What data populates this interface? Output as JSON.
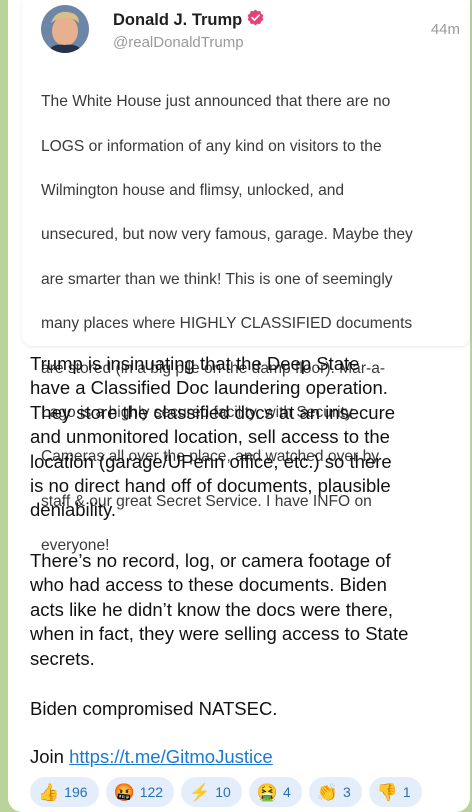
{
  "embedded_post": {
    "author_name": "Donald J. Trump",
    "handle": "@realDonaldTrump",
    "time": "44m",
    "lines": [
      "The White House just announced that there are no",
      "LOGS or information of any kind on visitors to the",
      "Wilmington house and flimsy, unlocked, and",
      "unsecured, but now very famous, garage. Maybe they",
      "are smarter than we think! This is one of seemingly",
      "many places where HIGHLY CLASSIFIED documents",
      "are stored (in a big pile on the damp floor). Mar-a-",
      "Lago is a highly secured facility, with Security",
      "Cameras all over the place, and watched over by",
      "staff & our great Secret Service. I have INFO on",
      "everyone!"
    ]
  },
  "message": {
    "paragraph1_lines": [
      "Trump is insinuating that the Deep State",
      "have a Classified Doc laundering operation.",
      "They store the classified docs at an insecure",
      "and unmonitored location, sell access to the",
      "location (garage/UPenn office, etc.) so there",
      "is no direct hand off of documents, plausible",
      "deniability."
    ],
    "paragraph2_lines": [
      "There’s no record, log, or camera footage of",
      "who had access to these documents. Biden",
      "acts like he didn’t know the docs were there,",
      "when in fact, they were selling access to State",
      "secrets."
    ],
    "paragraph3": "Biden compromised NATSEC.",
    "join_prefix": "Join",
    "join_link": "https://t.me/GitmoJustice"
  },
  "reactions": [
    {
      "emoji": "👍",
      "count": "196"
    },
    {
      "emoji": "🤬",
      "count": "122"
    },
    {
      "emoji": "⚡",
      "count": "10"
    },
    {
      "emoji": "🤮",
      "count": "4"
    },
    {
      "emoji": "👏",
      "count": "3"
    },
    {
      "emoji": "👎",
      "count": "1"
    }
  ],
  "colors": {
    "link": "#1a79d2",
    "verified_badge": "#e5407b",
    "reaction_bg": "#e3eefa",
    "chat_background": "#b9d39a"
  }
}
